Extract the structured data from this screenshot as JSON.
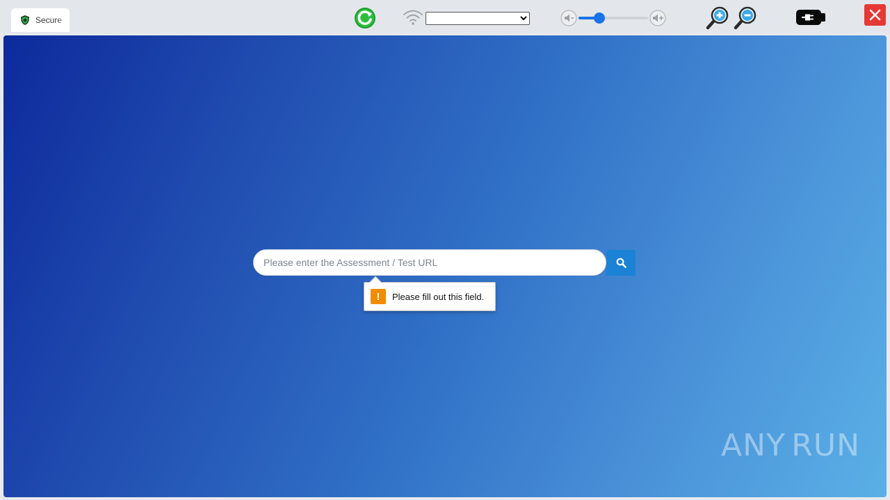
{
  "toolbar": {
    "tab": {
      "label": "Secure",
      "icon": "shield-icon"
    },
    "icons": {
      "refresh": "refresh-icon",
      "wifi": "wifi-icon",
      "volume_down": "volume-down-icon",
      "volume_up": "volume-up-icon",
      "zoom_in": "zoom-in-icon",
      "zoom_out": "zoom-out-icon",
      "power": "power-plug-icon",
      "close": "close-icon"
    },
    "network_select": {
      "value": ""
    },
    "volume": {
      "level": 0.3
    },
    "colors": {
      "close": "#e53935",
      "slider": "#1a73e8",
      "refresh": "#1f9c2f"
    }
  },
  "page": {
    "search": {
      "placeholder": "Please enter the Assessment / Test URL",
      "value": "",
      "button_icon": "search-icon"
    },
    "validation": {
      "message": "Please fill out this field.",
      "icon": "warning-icon",
      "icon_symbol": "!"
    },
    "watermark": {
      "text_left": "ANY",
      "text_right": "RUN"
    },
    "colors": {
      "gradient_start": "#0d2a9c",
      "gradient_end": "#5ab0e6",
      "search_button": "#1b82d6",
      "warning": "#f08c00"
    }
  }
}
